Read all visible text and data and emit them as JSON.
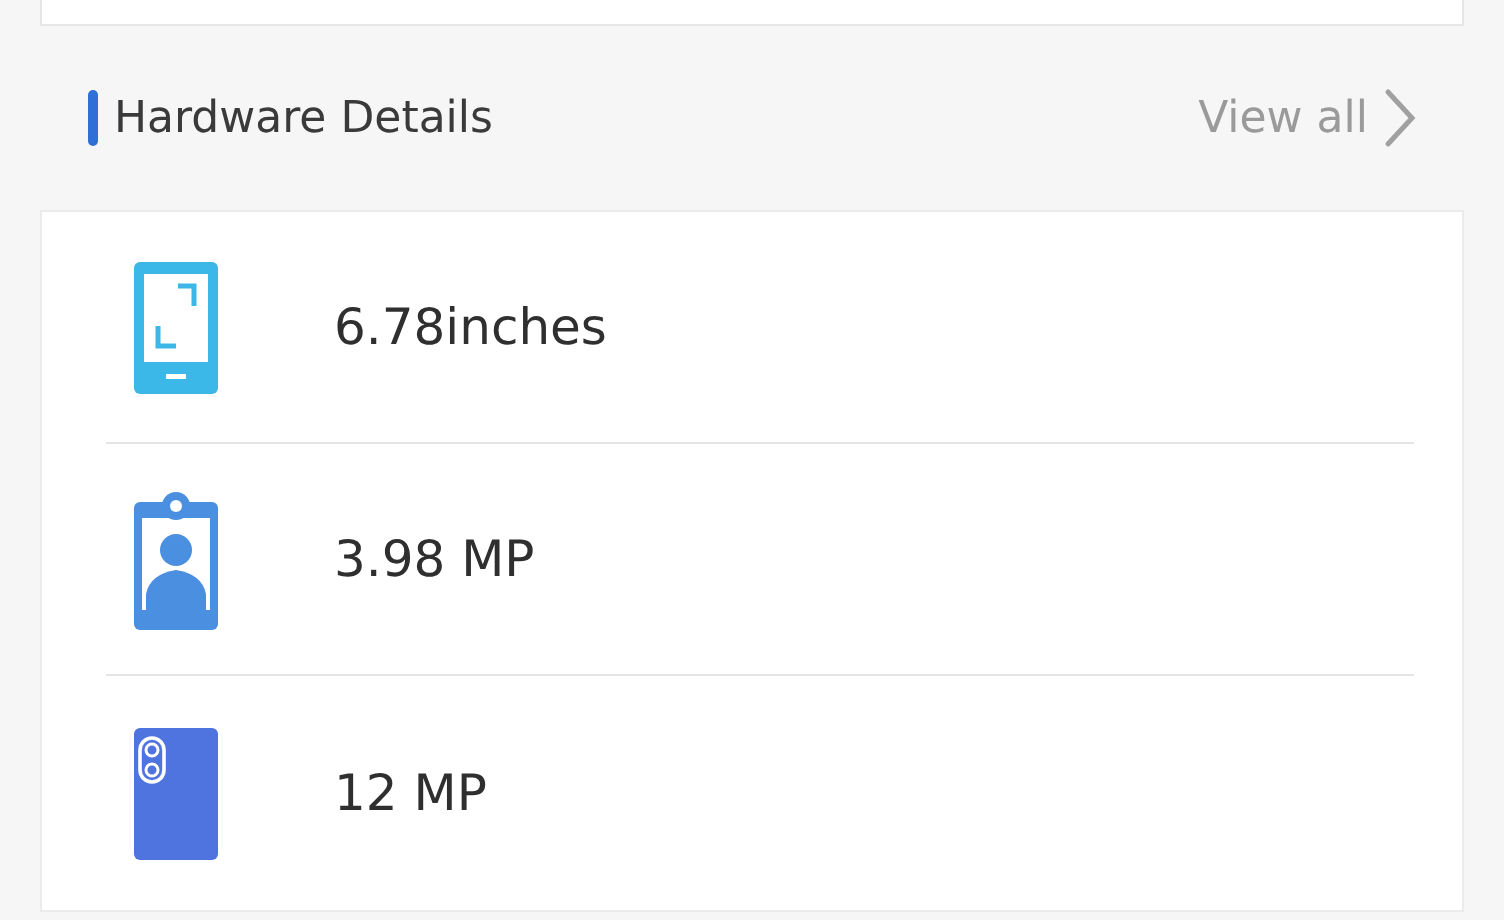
{
  "section": {
    "title": "Hardware Details",
    "link": "View all"
  },
  "items": [
    {
      "kind": "screen",
      "value": "6.78inches"
    },
    {
      "kind": "front_camera",
      "value": "3.98 MP"
    },
    {
      "kind": "rear_camera",
      "value": "12 MP"
    }
  ]
}
